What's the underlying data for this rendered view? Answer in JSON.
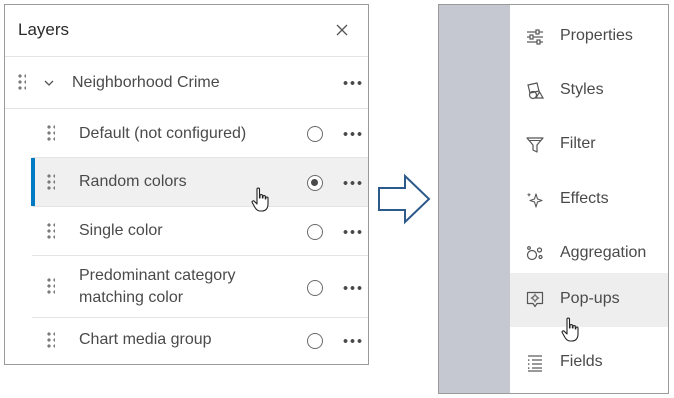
{
  "layers_panel": {
    "title": "Layers",
    "close_label": "×",
    "group": {
      "name": "Neighborhood Crime"
    },
    "styles": [
      {
        "label": "Default (not configured)",
        "selected": false
      },
      {
        "label": "Random colors",
        "selected": true
      },
      {
        "label": "Single color",
        "selected": false
      },
      {
        "label": "Predominant category matching color",
        "selected": false
      },
      {
        "label": "Chart media group",
        "selected": false
      }
    ]
  },
  "properties_menu": {
    "items": [
      {
        "label": "Properties",
        "icon": "sliders-icon"
      },
      {
        "label": "Styles",
        "icon": "shapes-icon"
      },
      {
        "label": "Filter",
        "icon": "filter-icon"
      },
      {
        "label": "Effects",
        "icon": "sparkle-icon"
      },
      {
        "label": "Aggregation",
        "icon": "aggregation-icon"
      },
      {
        "label": "Pop-ups",
        "icon": "popup-icon",
        "selected": true
      },
      {
        "label": "Fields",
        "icon": "fields-icon"
      }
    ]
  },
  "colors": {
    "accent": "#007ac2",
    "selected_row": "#f0f0f0",
    "sidebar_strip": "#c5c8d0",
    "arrow_stroke": "#2d5a8a"
  }
}
